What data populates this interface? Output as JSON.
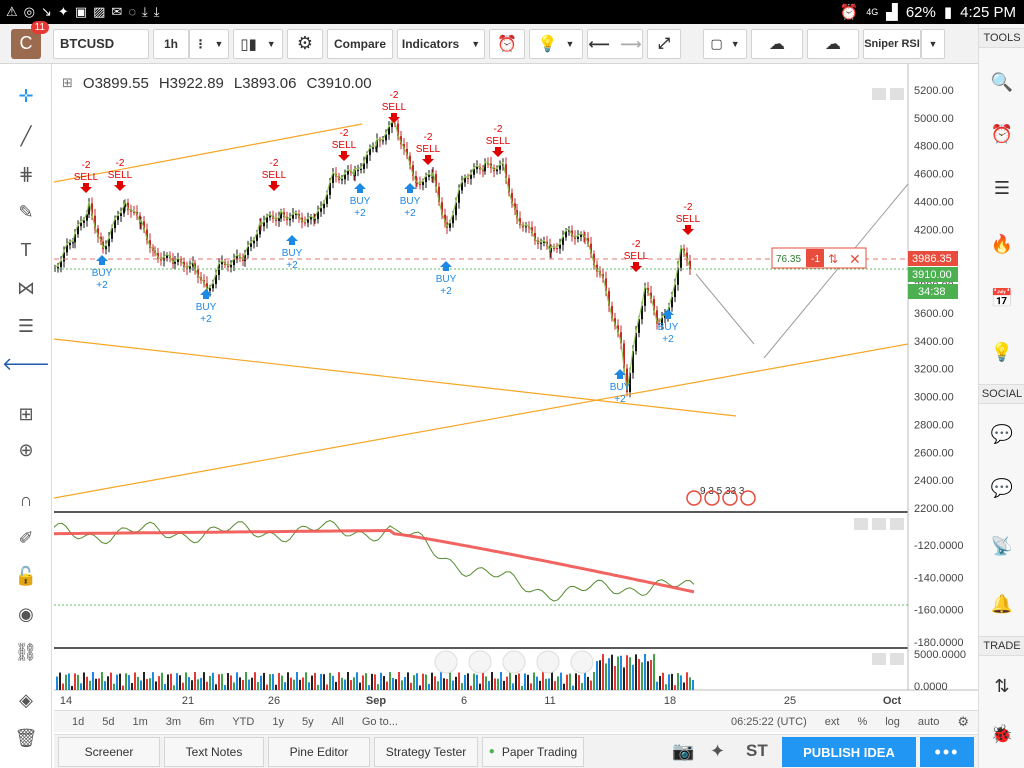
{
  "statusbar": {
    "network": "4G",
    "battery": "62%",
    "time": "4:25 PM"
  },
  "avatar": {
    "letter": "C",
    "badge": "11"
  },
  "toolbar": {
    "symbol": "BTCUSD",
    "interval": "1h",
    "compare": "Compare",
    "indicators": "Indicators",
    "script": "Sniper RSI"
  },
  "rightbar": {
    "tools": "TOOLS",
    "social": "SOCIAL",
    "trade": "TRADE"
  },
  "ohlc": {
    "o_label": "O",
    "o": "3899.55",
    "h_label": "H",
    "h": "3922.89",
    "l_label": "L",
    "l": "3893.06",
    "c_label": "C",
    "c": "3910.00"
  },
  "price_axis": [
    "5200.00",
    "5000.00",
    "4800.00",
    "4600.00",
    "4400.00",
    "4200.00",
    "3800.00",
    "3600.00",
    "3400.00",
    "3200.00",
    "3000.00",
    "2800.00",
    "2600.00",
    "2400.00",
    "2200.00"
  ],
  "price_tags": {
    "line_price": "3986.35",
    "last_price": "3910.00",
    "countdown": "34:38"
  },
  "order_line": {
    "qty": "76.35",
    "side": "-1"
  },
  "indicator_axis": [
    "-120.0000",
    "-140.0000",
    "-160.0000",
    "-180.0000"
  ],
  "volume_axis": [
    "5000.0000",
    "0.0000"
  ],
  "time_axis": [
    "14",
    "21",
    "26",
    "Sep",
    "6",
    "11",
    "18",
    "25",
    "Oct"
  ],
  "signals": {
    "sell": "SELL",
    "buy": "BUY",
    "sell_qty": "-2",
    "buy_qty": "+2"
  },
  "events_label": "9 3 5 33 3",
  "time_nav": {
    "ranges": [
      "1d",
      "5d",
      "1m",
      "3m",
      "6m",
      "YTD",
      "1y",
      "5y",
      "All"
    ],
    "goto": "Go to...",
    "clock": "06:25:22 (UTC)",
    "ext": "ext",
    "pct": "%",
    "log": "log",
    "auto": "auto"
  },
  "bottom_tabs": [
    "Screener",
    "Text Notes",
    "Pine Editor",
    "Strategy Tester",
    "Paper Trading"
  ],
  "publish": "PUBLISH IDEA",
  "colors": {
    "accent": "#2196f3",
    "sell": "#e00000",
    "buy": "#1e88e5",
    "trend": "#f5a623",
    "indicator": "#ef5350",
    "price_tag": "#e74c3c",
    "last_tag": "#4caf50"
  }
}
